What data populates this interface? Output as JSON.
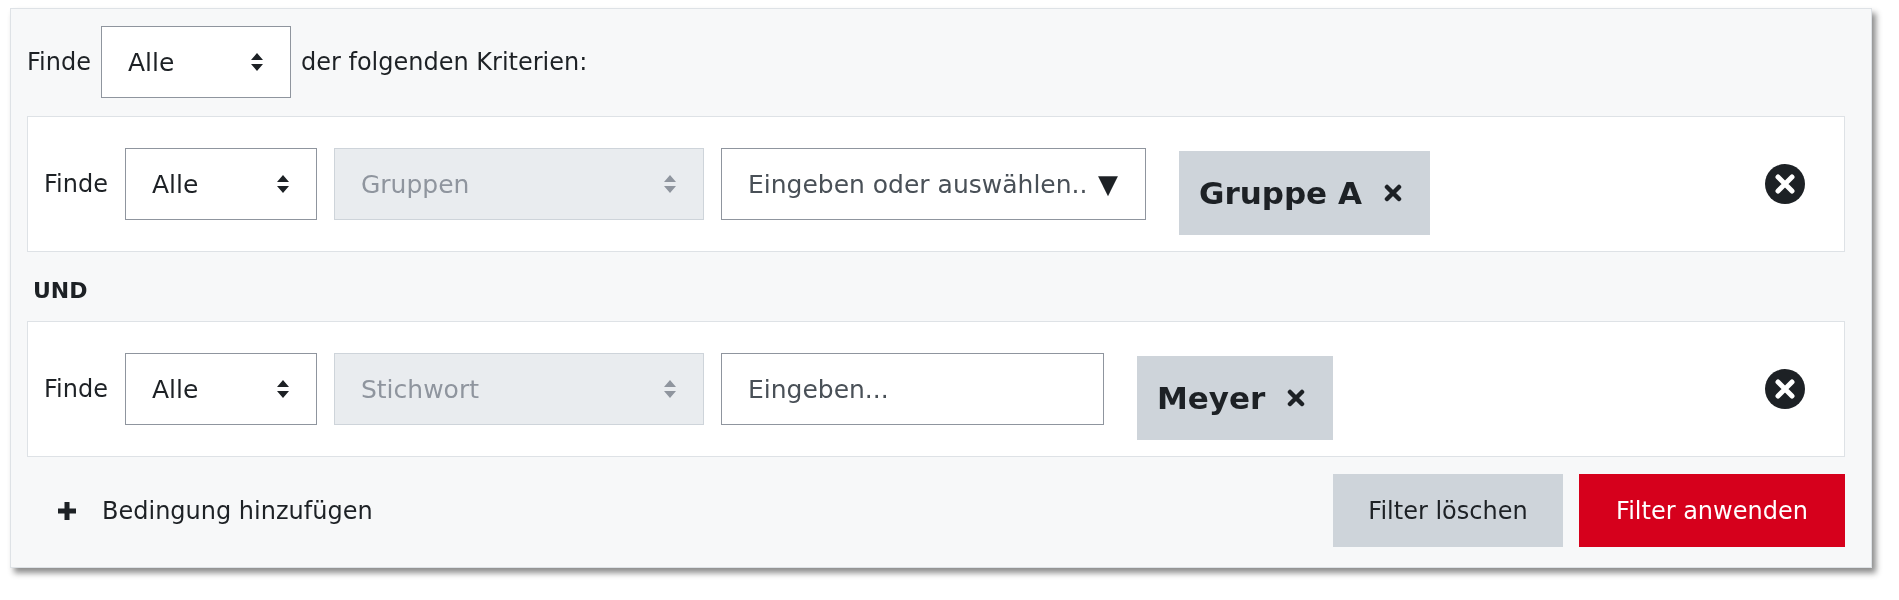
{
  "header": {
    "label": "Finde",
    "match_select": {
      "value": "Alle",
      "disabled": false
    },
    "suffix": "der folgenden Kriterien:"
  },
  "conditions": [
    {
      "label": "Finde",
      "match_select": {
        "value": "Alle",
        "disabled": false
      },
      "type_select": {
        "value": "Gruppen",
        "disabled": true
      },
      "input": {
        "placeholder": "Eingeben oder auswählen..",
        "dropdown_glyph": "▼"
      },
      "tags": [
        {
          "label": "Gruppe A"
        }
      ]
    },
    {
      "label": "Finde",
      "match_select": {
        "value": "Alle",
        "disabled": false
      },
      "type_select": {
        "value": "Stichwort",
        "disabled": true
      },
      "input": {
        "placeholder": "Eingeben..."
      },
      "tags": [
        {
          "label": "Meyer"
        }
      ]
    }
  ],
  "joiner": "UND",
  "add_condition": "Bedingung hinzufügen",
  "buttons": [
    {
      "label": "Filter löschen",
      "kind": "secondary"
    },
    {
      "label": "Filter anwenden",
      "kind": "primary"
    }
  ]
}
